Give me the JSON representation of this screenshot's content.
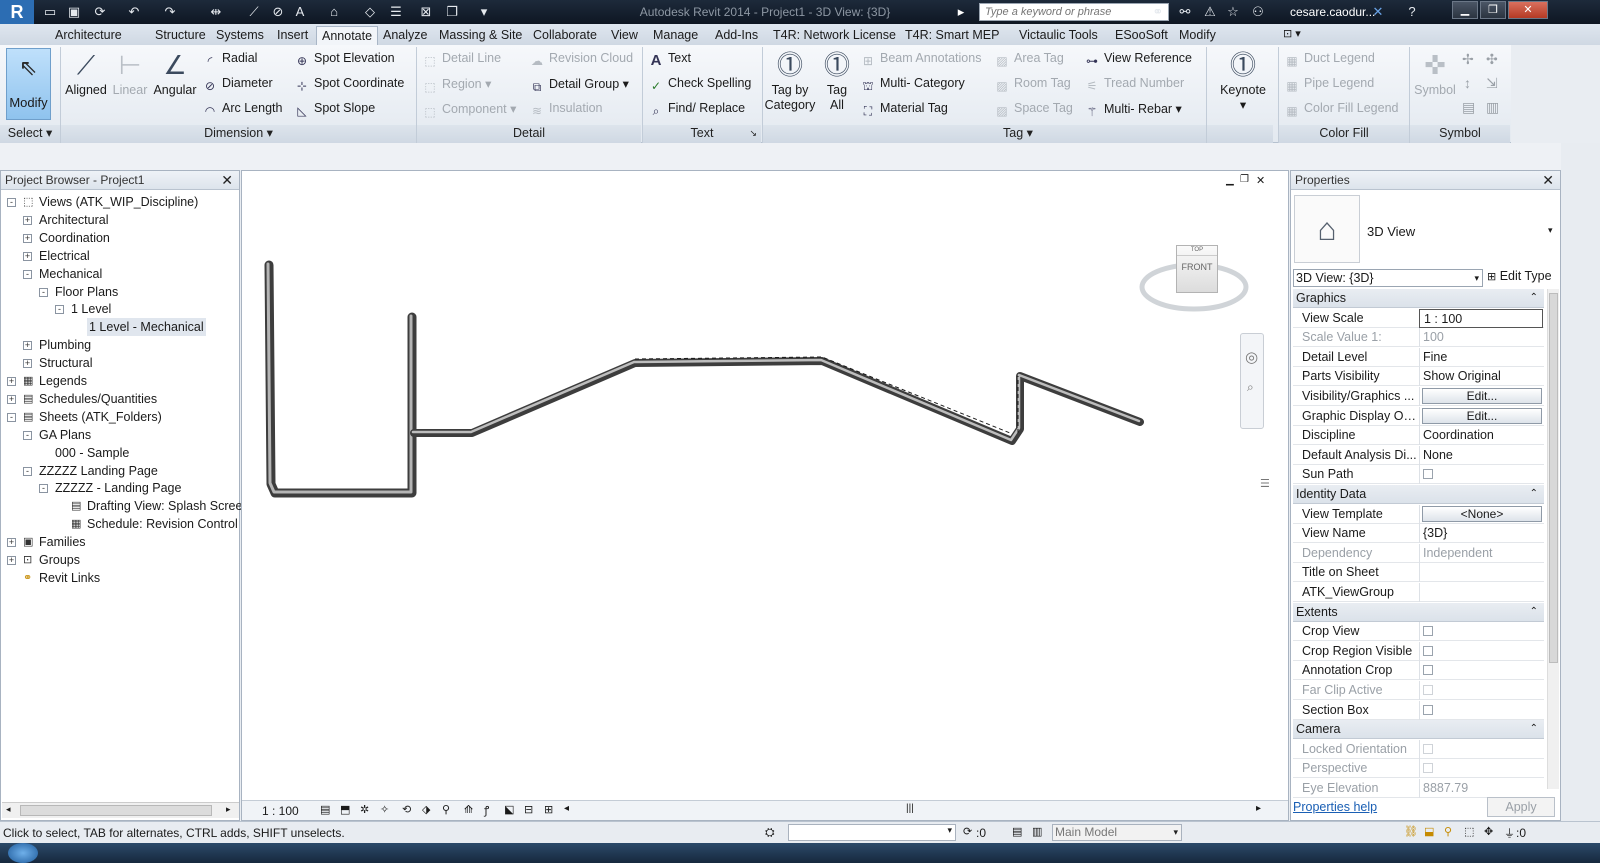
{
  "titlebar": {
    "title": "Autodesk Revit 2014 -    Project1 - 3D View: {3D}",
    "search_placeholder": "Type a keyword or phrase",
    "user": "cesare.caodur...",
    "app_icon": "revit-app-icon"
  },
  "tabs": [
    "Architecture",
    "Structure",
    "Systems",
    "Insert",
    "Annotate",
    "Analyze",
    "Massing & Site",
    "Collaborate",
    "View",
    "Manage",
    "Add-Ins",
    "T4R: Network License",
    "T4R: Smart MEP",
    "Victaulic Tools",
    "ESooSoft",
    "Modify"
  ],
  "active_tab": "Annotate",
  "ribbon": {
    "select": {
      "modify": "Modify",
      "panel": "Select"
    },
    "dimension": {
      "aligned": "Aligned",
      "linear": "Linear",
      "angular": "Angular",
      "radial": "Radial",
      "diameter": "Diameter",
      "arc_length": "Arc  Length",
      "spot_elevation": "Spot  Elevation",
      "spot_coordinate": "Spot  Coordinate",
      "spot_slope": "Spot  Slope",
      "panel": "Dimension"
    },
    "detail": {
      "detail_line": "Detail  Line",
      "region": "Region",
      "component": "Component",
      "revision_cloud": "Revision  Cloud",
      "detail_group": "Detail  Group",
      "insulation": "Insulation",
      "panel": "Detail"
    },
    "text": {
      "text": "Text",
      "check_spelling": "Check  Spelling",
      "find_replace": "Find/  Replace",
      "panel": "Text"
    },
    "tag": {
      "tag_by_category_1": "Tag by",
      "tag_by_category_2": "Category",
      "tag_all_1": "Tag",
      "tag_all_2": "All",
      "beam_annotations": "Beam  Annotations",
      "multi_category": "Multi- Category",
      "material_tag": "Material  Tag",
      "area_tag": "Area  Tag",
      "room_tag": "Room  Tag",
      "space_tag": "Space  Tag",
      "view_reference": "View  Reference",
      "tread_number": "Tread  Number",
      "multi_rebar": "Multi- Rebar",
      "panel": "Tag"
    },
    "keynote": {
      "label": "Keynote"
    },
    "color_fill": {
      "duct_legend": "Duct  Legend",
      "pipe_legend": "Pipe  Legend",
      "color_fill_legend": "Color Fill  Legend",
      "panel": "Color Fill"
    },
    "symbol": {
      "label": "Symbol",
      "panel": "Symbol"
    }
  },
  "browser": {
    "title": "Project Browser - Project1",
    "items": [
      {
        "label": "Views (ATK_WIP_Discipline)",
        "level": 0,
        "exp": "-"
      },
      {
        "label": "Architectural",
        "level": 1,
        "exp": "+"
      },
      {
        "label": "Coordination",
        "level": 1,
        "exp": "+"
      },
      {
        "label": "Electrical",
        "level": 1,
        "exp": "+"
      },
      {
        "label": "Mechanical",
        "level": 1,
        "exp": "-"
      },
      {
        "label": "Floor Plans",
        "level": 2,
        "exp": "-"
      },
      {
        "label": "1 Level",
        "level": 3,
        "exp": "-"
      },
      {
        "label": "1 Level - Mechanical",
        "level": 4,
        "exp": ""
      },
      {
        "label": "Plumbing",
        "level": 1,
        "exp": "+"
      },
      {
        "label": "Structural",
        "level": 1,
        "exp": "+"
      },
      {
        "label": "Legends",
        "level": 0,
        "exp": "+"
      },
      {
        "label": "Schedules/Quantities",
        "level": 0,
        "exp": "+"
      },
      {
        "label": "Sheets (ATK_Folders)",
        "level": 0,
        "exp": "-"
      },
      {
        "label": "GA Plans",
        "level": 1,
        "exp": "-"
      },
      {
        "label": "000 - Sample",
        "level": 2,
        "exp": ""
      },
      {
        "label": "ZZZZZ Landing Page",
        "level": 1,
        "exp": "-"
      },
      {
        "label": "ZZZZZ - Landing Page",
        "level": 2,
        "exp": "-"
      },
      {
        "label": "Drafting View: Splash Screen",
        "level": 3,
        "exp": ""
      },
      {
        "label": "Schedule: Revision Control",
        "level": 3,
        "exp": ""
      },
      {
        "label": "Families",
        "level": 0,
        "exp": "+"
      },
      {
        "label": "Groups",
        "level": 0,
        "exp": "+"
      },
      {
        "label": "Revit Links",
        "level": 0,
        "exp": ""
      }
    ]
  },
  "view": {
    "scale": "1 : 100",
    "viewcube_front": "FRONT",
    "viewcube_top": "TOP"
  },
  "properties": {
    "title": "Properties",
    "type_name": "3D View",
    "selector": "3D View: {3D}",
    "edit_type": "Edit Type",
    "groups": {
      "graphics": "Graphics",
      "identity": "Identity Data",
      "extents": "Extents",
      "camera": "Camera"
    },
    "rows": {
      "view_scale": [
        "View Scale",
        "1 : 100"
      ],
      "scale_value": [
        "Scale Value    1:",
        "100"
      ],
      "detail_level": [
        "Detail Level",
        "Fine"
      ],
      "parts_visibility": [
        "Parts Visibility",
        "Show Original"
      ],
      "visibility_graphics": [
        "Visibility/Graphics ...",
        "Edit..."
      ],
      "graphic_display": [
        "Graphic Display Op...",
        "Edit..."
      ],
      "discipline": [
        "Discipline",
        "Coordination"
      ],
      "default_analysis": [
        "Default Analysis Di...",
        "None"
      ],
      "sun_path": [
        "Sun Path",
        ""
      ],
      "view_template": [
        "View Template",
        "<None>"
      ],
      "view_name": [
        "View Name",
        "{3D}"
      ],
      "dependency": [
        "Dependency",
        "Independent"
      ],
      "title_on_sheet": [
        "Title on Sheet",
        ""
      ],
      "atk_viewgroup": [
        "ATK_ViewGroup",
        ""
      ],
      "crop_view": [
        "Crop View",
        ""
      ],
      "crop_region_visible": [
        "Crop Region Visible",
        ""
      ],
      "annotation_crop": [
        "Annotation Crop",
        ""
      ],
      "far_clip_active": [
        "Far Clip Active",
        ""
      ],
      "section_box": [
        "Section Box",
        ""
      ],
      "locked_orientation": [
        "Locked Orientation",
        ""
      ],
      "perspective": [
        "Perspective",
        ""
      ],
      "eye_elevation": [
        "Eye Elevation",
        "8887.79"
      ]
    },
    "help": "Properties help",
    "apply": "Apply"
  },
  "statusbar": {
    "message": "Click to select, TAB for alternates, CTRL adds, SHIFT unselects.",
    "filter_count": ":0",
    "model": "Main Model",
    "selection_count": ":0"
  }
}
